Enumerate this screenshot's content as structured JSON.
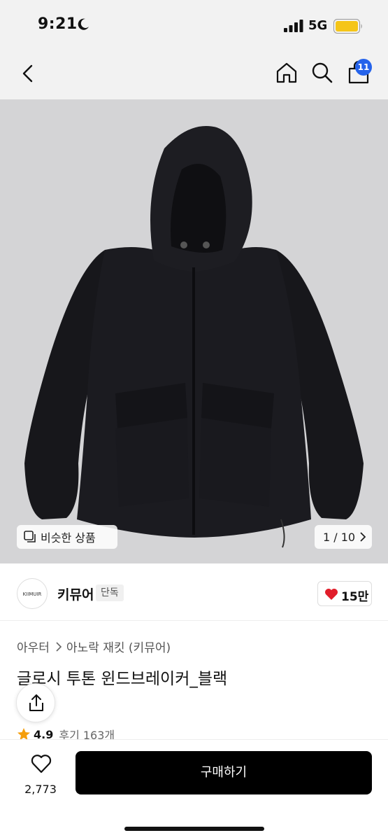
{
  "status_bar": {
    "time": "9:21",
    "network": "5G"
  },
  "nav": {
    "cart_count": "11"
  },
  "gallery": {
    "similar_label": "비슷한 상품",
    "page_indicator": "1 / 10"
  },
  "brand": {
    "logo_text": "KIIMUIR",
    "name": "키뮤어",
    "tag": "단독",
    "likes": "15만"
  },
  "product": {
    "breadcrumb": [
      "아우터",
      "아노락 재킷 (키뮤어)"
    ],
    "title": "글로시 투톤 윈드브레이커_블랙",
    "rating": "4.9",
    "reviews": "후기 163개"
  },
  "bottom": {
    "wish_count": "2,773",
    "buy_label": "구매하기"
  },
  "colors": {
    "accent_blue": "#2563eb",
    "heart_red": "#e11d2a",
    "star_orange": "#f59e0b",
    "battery_yellow": "#f5c518"
  }
}
